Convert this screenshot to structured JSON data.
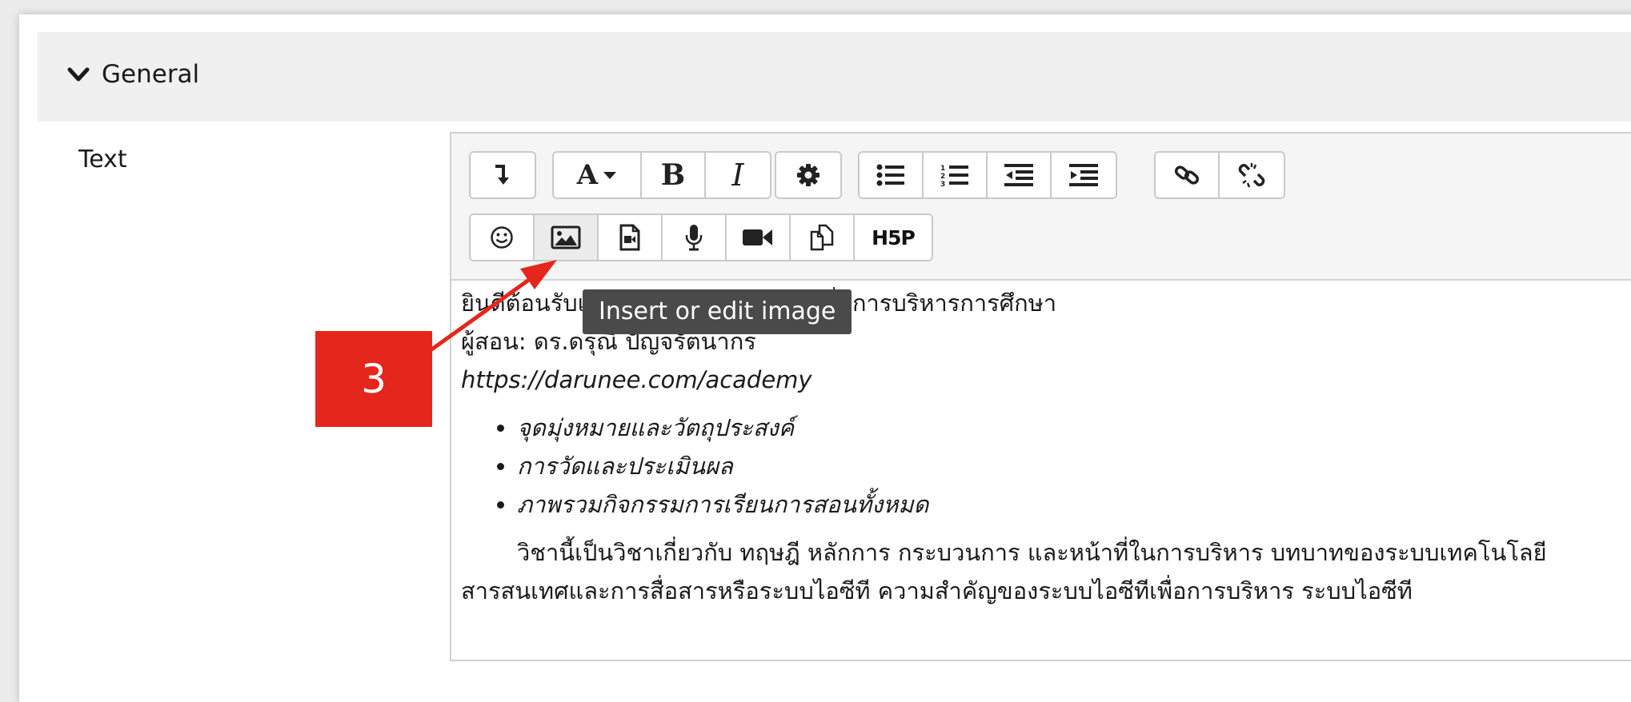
{
  "section": {
    "title": "General"
  },
  "field": {
    "label": "Text"
  },
  "toolbar": {
    "row1": [
      {
        "name": "show-more-buttons",
        "icon": "collapse-icon"
      },
      {
        "name": "font-style",
        "icon": "font-style-icon",
        "text": "A"
      },
      {
        "name": "bold",
        "icon": "bold-icon",
        "text": "B"
      },
      {
        "name": "italic",
        "icon": "italic-icon",
        "text": "I"
      },
      {
        "name": "settings",
        "icon": "gear-icon"
      },
      {
        "name": "unordered-list",
        "icon": "unordered-list-icon"
      },
      {
        "name": "ordered-list",
        "icon": "ordered-list-icon"
      },
      {
        "name": "outdent",
        "icon": "outdent-icon"
      },
      {
        "name": "indent",
        "icon": "indent-icon"
      },
      {
        "name": "link",
        "icon": "link-icon"
      },
      {
        "name": "unlink",
        "icon": "unlink-icon"
      }
    ],
    "row2": [
      {
        "name": "emoji",
        "icon": "smiley-icon"
      },
      {
        "name": "insert-image",
        "icon": "image-icon"
      },
      {
        "name": "media",
        "icon": "media-file-icon"
      },
      {
        "name": "record-audio",
        "icon": "microphone-icon"
      },
      {
        "name": "record-video",
        "icon": "video-camera-icon"
      },
      {
        "name": "manage-files",
        "icon": "files-icon"
      },
      {
        "name": "h5p",
        "icon": "h5p-icon",
        "text": "H5P"
      }
    ]
  },
  "tooltip": {
    "text": "Insert or edit image"
  },
  "content": {
    "line1": "ยินดีต้อนรับเข้าสู่รายวิชา นวัตกรรมเพื่อการบริหารการศึกษา",
    "line2": "ผู้สอน: ดร.ดรุณี ปัญจรัตนากร",
    "url": "https://darunee.com/academy",
    "bullets": [
      "จุดมุ่งหมายและวัตถุประสงค์",
      "การวัดและประเมินผล",
      "ภาพรวมกิจกรรมการเรียนการสอนทั้งหมด"
    ],
    "desc": "วิชานี้เป็นวิชาเกี่ยวกับ ทฤษฎี หลักการ กระบวนการ และหน้าที่ในการบริหาร บทบาทของระบบเทคโนโลยีสารสนเทศและการสื่อสารหรือระบบไอซีที ความสำคัญของระบบไอซีทีเพื่อการบริหาร ระบบไอซีที"
  },
  "annotation": {
    "step_number": "3",
    "color": "#e5261c"
  }
}
